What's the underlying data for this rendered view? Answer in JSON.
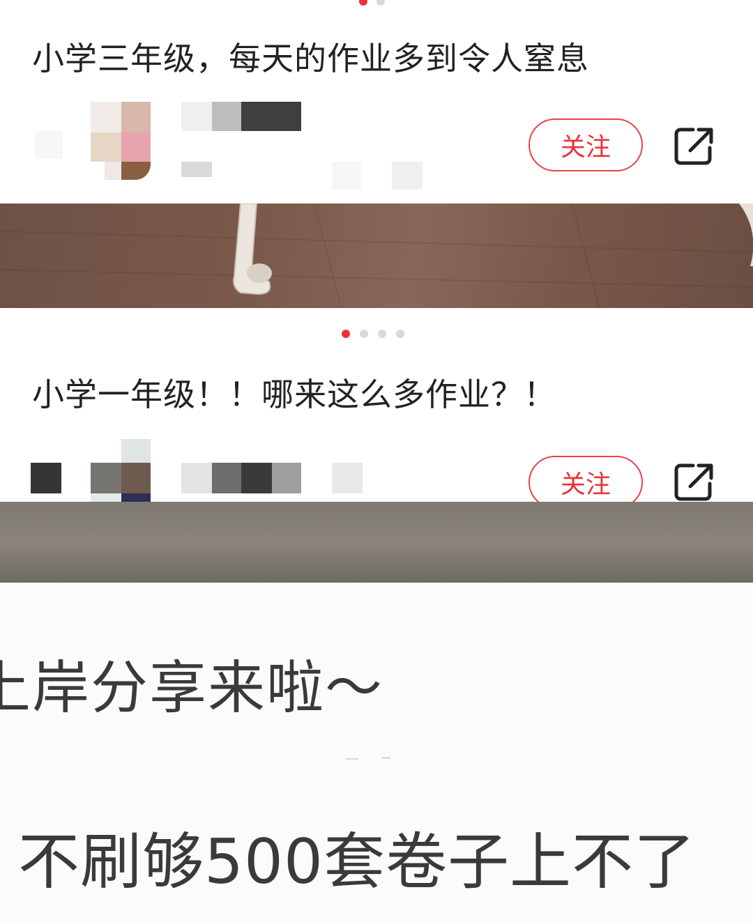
{
  "posts": [
    {
      "title": "小学三年级，每天的作业多到令人窒息",
      "follow_label": "关注",
      "share_icon": "share-icon"
    },
    {
      "title": "小学一年级！！哪来这么多作业？！",
      "follow_label": "关注",
      "share_icon": "share-icon"
    }
  ],
  "carousel": {
    "dots": 4,
    "active": 0
  },
  "overlay_lines": [
    "上岸分享来啦～",
    "不刷够500套卷子上不了"
  ],
  "colors": {
    "accent": "#e8333d",
    "floor": "#7d5c4c"
  }
}
